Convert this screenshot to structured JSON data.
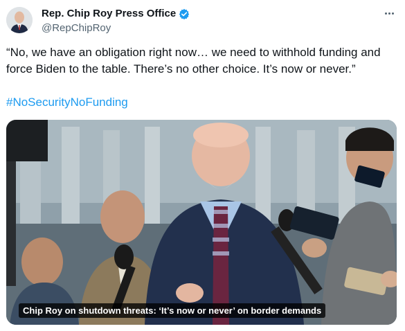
{
  "author": {
    "display_name": "Rep. Chip Roy Press Office",
    "handle": "@RepChipRoy",
    "verified": true
  },
  "tweet": {
    "text": "“No, we have an obligation right now… we need to withhold funding and force Biden to the table. There’s no other choice. It’s now or never.”",
    "hashtag": "#NoSecurityNoFunding"
  },
  "media": {
    "caption": "Chip Roy on shutdown threats: ‘It’s now or never’ on border demands"
  },
  "colors": {
    "link": "#1d9bf0",
    "verified_badge": "#1d9bf0",
    "secondary_text": "#536471"
  },
  "icons": {
    "verified": "verified-badge-icon",
    "more": "more-options-icon"
  }
}
